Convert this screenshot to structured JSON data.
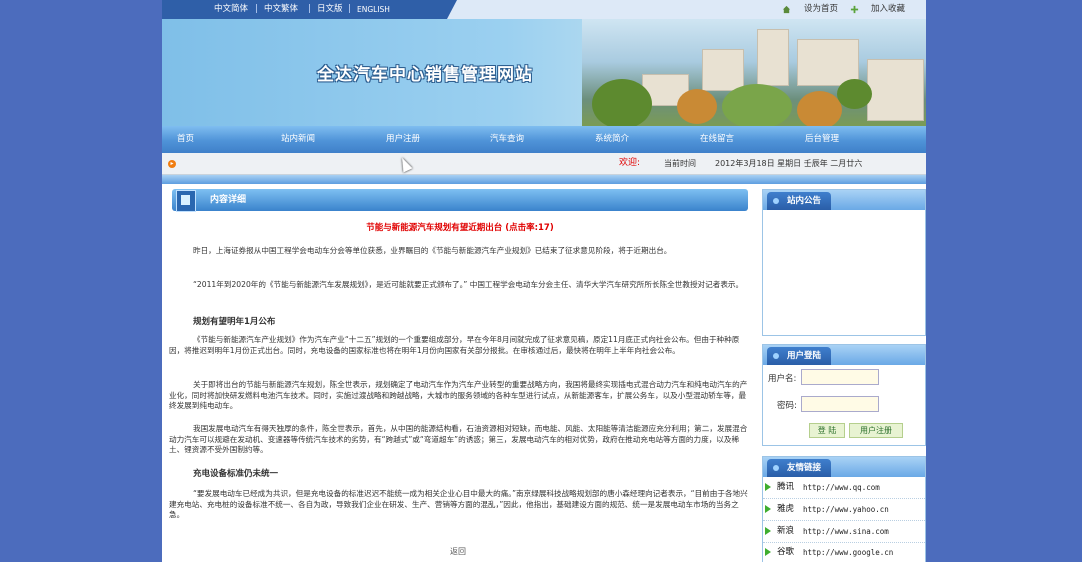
{
  "top_bar": {
    "languages": [
      "中文简体",
      "中文繁体",
      "日文版",
      "ENGLISH"
    ],
    "separator": "|",
    "set_home": "设为首页",
    "add_favorite": "加入收藏"
  },
  "banner": {
    "site_title": "全达汽车中心销售管理网站"
  },
  "nav": {
    "items": [
      "首页",
      "站内新闻",
      "用户注册",
      "汽车查询",
      "系统简介",
      "在线留言",
      "后台管理"
    ]
  },
  "info_bar": {
    "welcome": "欢迎:",
    "time_label": "当前时间",
    "date_text": "2012年3月18日  星期日  壬辰年 二月廿六"
  },
  "content": {
    "section_title": "内容详细",
    "article_title": "节能与新能源汽车规划有望近期出台 (点击率:17)",
    "paragraphs": [
      "昨日，上海证券报从中国工程学会电动车分会等单位获悉，业界瞩目的《节能与新能源汽车产业规划》已结束了征求意见阶段，将于近期出台。",
      "“2011年到2020年的《节能与新能源汽车发展规划》，是近可能就要正式颁布了。” 中国工程学会电动车分会主任、清华大学汽车研究所所长陈全世教授对记者表示。",
      "《节能与新能源汽车产业规划》作为汽车产业“十二五”规划的一个重要组成部分，早在今年8月间就完成了征求意见稿，原定11月底正式向社会公布。但由于种种原因，将推迟到明年1月份正式出台。同时，充电设备的国家标准也将在明年1月份向国家有关部分报批。在审核通过后，最快将在明年上半年向社会公布。",
      "关于即将出台的节能与新能源汽车规划，陈全世表示，规划确定了电动汽车作为汽车产业转型的重要战略方向，我国将最终实现插电式混合动力汽车和纯电动汽车的产业化，同时将加快研发燃料电池汽车技术。同时，实施过渡战略和跨越战略，大城市的服务领域的各种车型进行试点，从新能源客车，扩展公务车，以及小型混动轿车等，最终发展到纯电动车。",
      "我国发展电动汽车有得天独厚的条件，陈全世表示，首先，从中国的能源结构看，石油资源相对短缺，而电能、风能、太阳能等清洁能源应充分利用；第二，发展混合动力汽车可以规避在发动机、变速器等传统汽车技术的劣势，有“跨越式”或“弯道超车”的诱惑；第三，发展电动汽车的相对优势，政府在推动充电站等方面的力度，以及稀土、锂资源不受外国制约等。",
      "“要发展电动车已经成为共识，但是充电设备的标准迟迟不能统一成为相关企业心目中最大的痛。”南京绿展科技战略规划部的唐小森经理向记者表示，“目前由于各地兴建充电站、充电桩的设备标准不统一、各自为政，导致我们企业在研发、生产、营销等方面的混乱，”因此，他指出，基础建设方面的规范、统一是发展电动车市场的当务之急。"
    ],
    "subheads": [
      "规划有望明年1月公布",
      "充电设备标准仍未统一"
    ],
    "back_label": "返回"
  },
  "sidebar": {
    "notice_title": "站内公告",
    "login": {
      "title": "用户登陆",
      "username_label": "用户名:",
      "password_label": "密码:",
      "login_button": "登 陆",
      "register_button": "用户注册"
    },
    "links": {
      "title": "友情链接",
      "items": [
        {
          "name": "腾讯",
          "url": "http://www.qq.com"
        },
        {
          "name": "雅虎",
          "url": "http://www.yahoo.cn"
        },
        {
          "name": "新浪",
          "url": "http://www.sina.com"
        },
        {
          "name": "谷歌",
          "url": "http://www.google.cn"
        }
      ]
    }
  },
  "colors": {
    "page_background": "#4c6cbd",
    "nav_blue": "#4f93d8",
    "headline_red": "#e00000"
  }
}
